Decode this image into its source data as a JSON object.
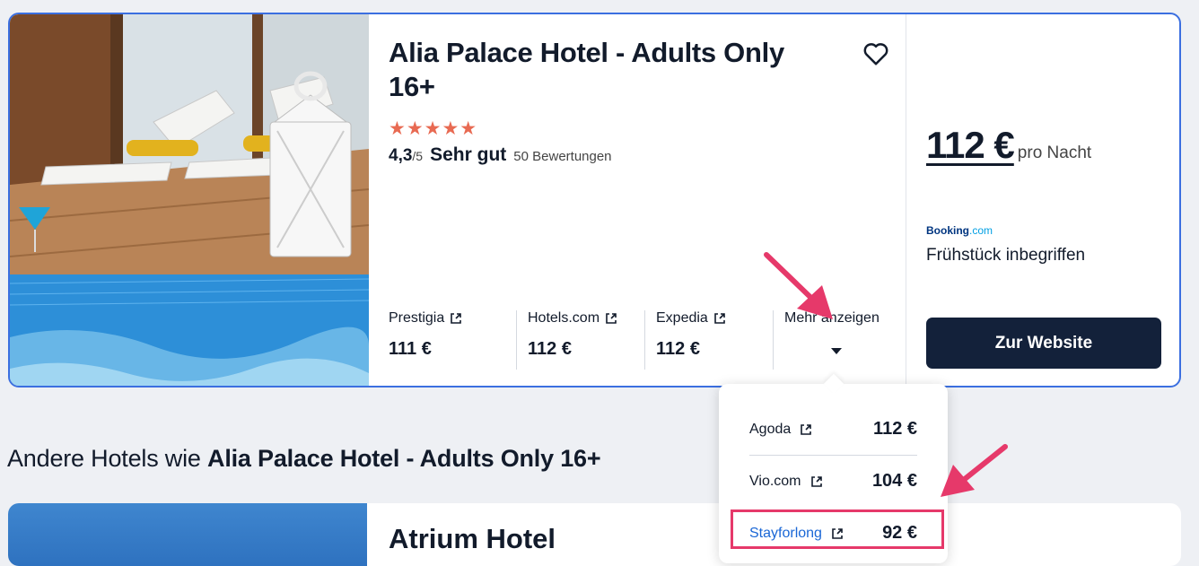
{
  "hotel": {
    "title": "Alia Palace Hotel - Adults Only 16+",
    "stars": "★★★★★",
    "rating_score": "4,3",
    "rating_scale": "/5",
    "rating_label": "Sehr gut",
    "review_count": "50 Bewertungen"
  },
  "providers": [
    {
      "name": "Prestigia",
      "price": "111 €"
    },
    {
      "name": "Hotels.com",
      "price": "112 €"
    },
    {
      "name": "Expedia",
      "price": "112 €"
    }
  ],
  "more_label": "Mehr anzeigen",
  "offer": {
    "price": "112 €",
    "unit": "pro Nacht",
    "provider_logo_main": "Booking",
    "provider_logo_suffix": ".com",
    "perk": "Frühstück inbegriffen",
    "cta": "Zur Website"
  },
  "dropdown": [
    {
      "name": "Agoda",
      "price": "112 €"
    },
    {
      "name": "Vio.com",
      "price": "104 €"
    },
    {
      "name": "Stayforlong",
      "price": "92 €"
    }
  ],
  "others": {
    "prefix": "Andere Hotels wie ",
    "hotel_name": "Alia Palace Hotel - Adults Only 16+"
  },
  "next_hotel": {
    "title": "Atrium Hotel"
  },
  "colors": {
    "accent_border": "#3b6fe0",
    "cta_bg": "#13213a",
    "star": "#e86a52",
    "annotation": "#e6396a"
  }
}
